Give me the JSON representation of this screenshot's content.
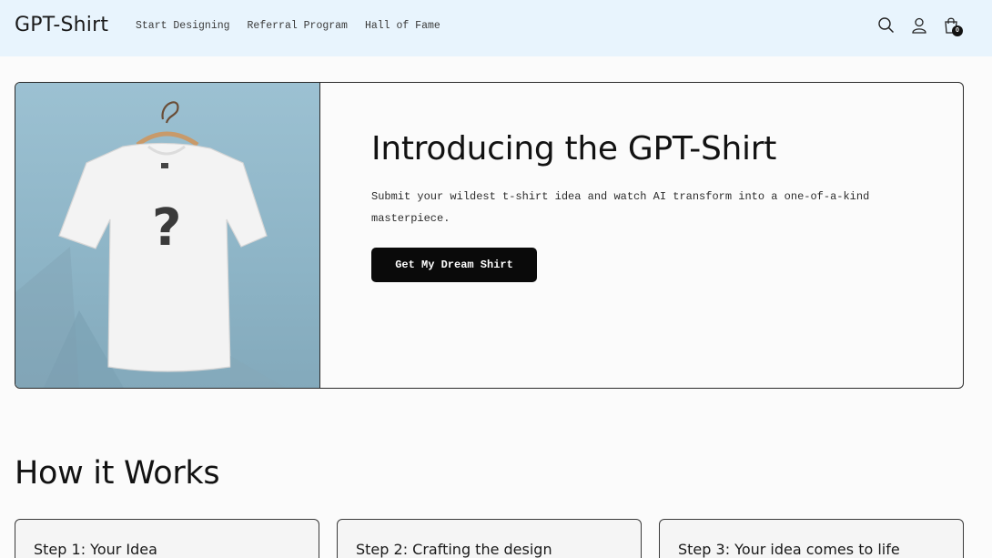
{
  "header": {
    "brand": "GPT-Shirt",
    "nav": [
      {
        "label": "Start Designing"
      },
      {
        "label": "Referral Program"
      },
      {
        "label": "Hall of Fame"
      }
    ],
    "icons": [
      "search-icon",
      "account-icon",
      "cart-icon"
    ],
    "cart_count": "0",
    "background_color": "#e8f4fd"
  },
  "hero": {
    "title": "Introducing the GPT-Shirt",
    "subtitle": "Submit your wildest t-shirt idea and watch AI transform into a one-of-a-kind masterpiece.",
    "cta_label": "Get My Dream Shirt",
    "image_glyph": "?"
  },
  "how": {
    "title": "How it Works",
    "steps": [
      {
        "label": "Step 1: Your Idea"
      },
      {
        "label": "Step 2: Crafting the design"
      },
      {
        "label": "Step 3: Your idea comes to life"
      }
    ]
  }
}
